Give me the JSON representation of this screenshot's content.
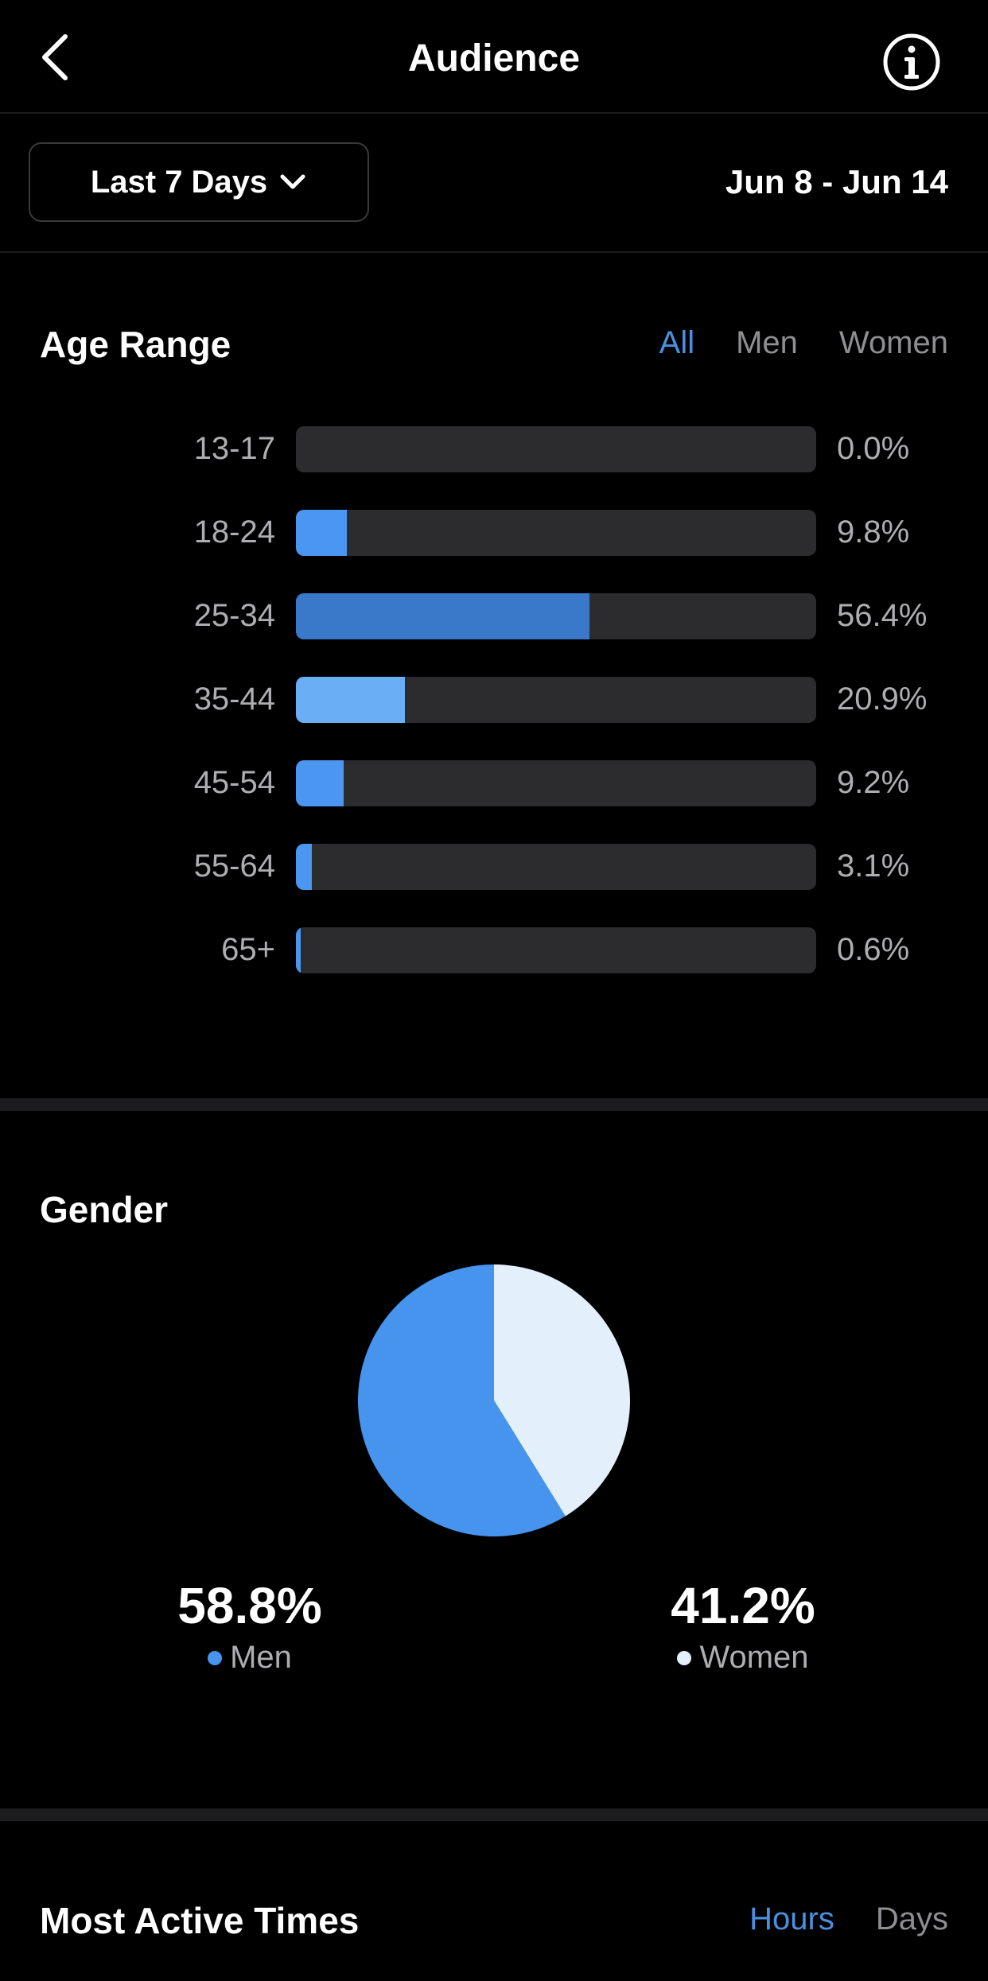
{
  "header": {
    "title": "Audience",
    "back_icon": "chevron-left-icon",
    "info_icon": "info-circle-icon"
  },
  "filter": {
    "period_label": "Last 7 Days",
    "date_range": "Jun 8 - Jun 14"
  },
  "age_range": {
    "title": "Age Range",
    "tabs": [
      {
        "label": "All",
        "active": true
      },
      {
        "label": "Men",
        "active": false
      },
      {
        "label": "Women",
        "active": false
      }
    ],
    "rows": [
      {
        "label": "13-17",
        "value": 0.0,
        "display": "0.0%",
        "color": "#4a96f0"
      },
      {
        "label": "18-24",
        "value": 9.8,
        "display": "9.8%",
        "color": "#4a96f0"
      },
      {
        "label": "25-34",
        "value": 56.4,
        "display": "56.4%",
        "color": "#3a78c9"
      },
      {
        "label": "35-44",
        "value": 20.9,
        "display": "20.9%",
        "color": "#6aaff5"
      },
      {
        "label": "45-54",
        "value": 9.2,
        "display": "9.2%",
        "color": "#4a96f0"
      },
      {
        "label": "55-64",
        "value": 3.1,
        "display": "3.1%",
        "color": "#4a96f0"
      },
      {
        "label": "65+",
        "value": 0.6,
        "display": "0.6%",
        "color": "#4a96f0"
      }
    ]
  },
  "gender": {
    "title": "Gender",
    "men": {
      "value": 58.8,
      "display": "58.8%",
      "label": "Men",
      "color": "#4694ee"
    },
    "women": {
      "value": 41.2,
      "display": "41.2%",
      "label": "Women",
      "color": "#e3f0fc"
    }
  },
  "active_times": {
    "title": "Most Active Times",
    "tabs": [
      {
        "label": "Hours",
        "active": true
      },
      {
        "label": "Days",
        "active": false
      }
    ]
  }
}
